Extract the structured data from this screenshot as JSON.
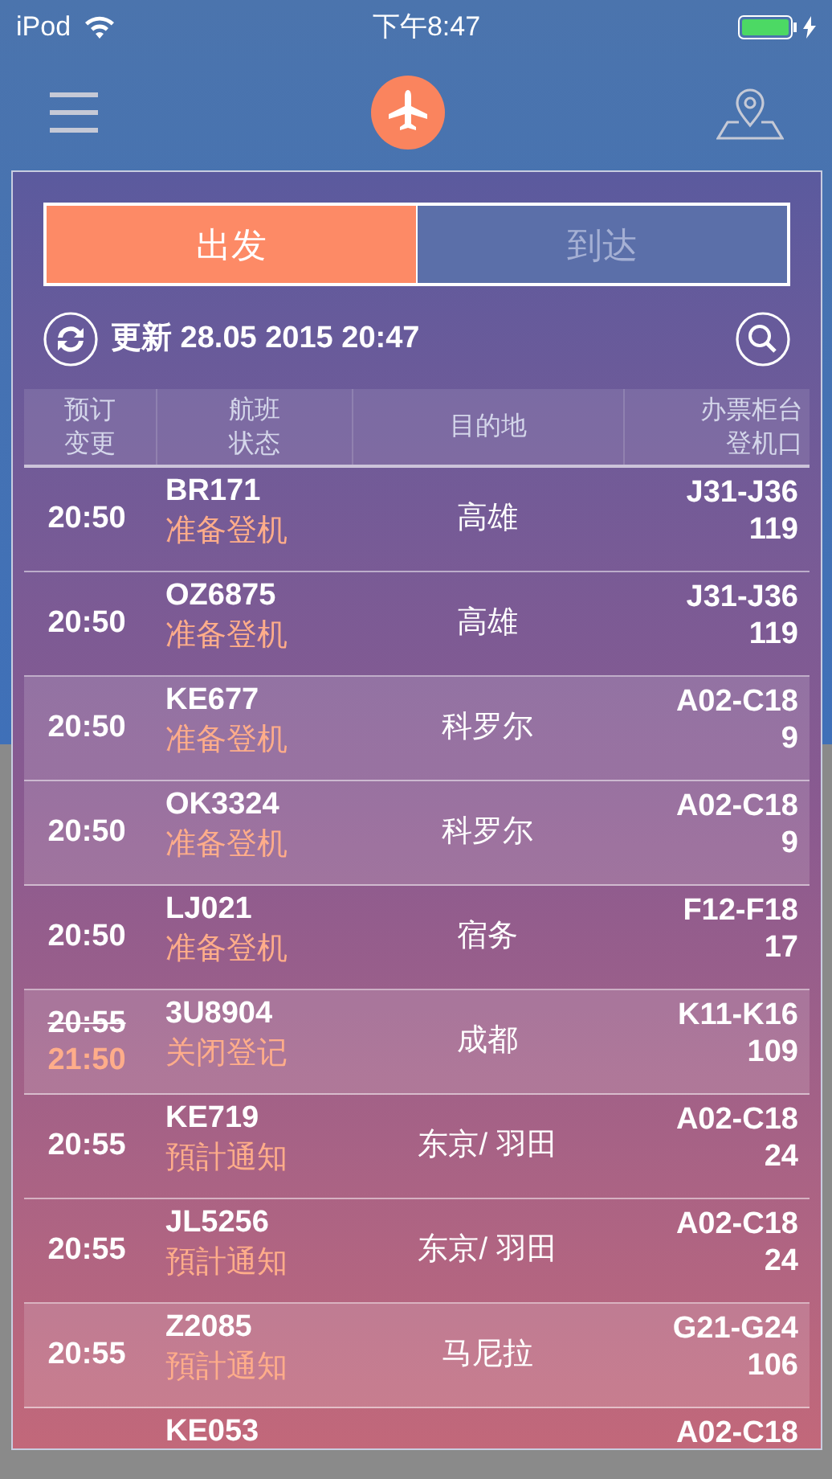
{
  "status_bar": {
    "device": "iPod",
    "time": "下午8:47",
    "charging": true
  },
  "tabs": [
    {
      "label": "出发",
      "selected": true
    },
    {
      "label": "到达",
      "selected": false
    }
  ],
  "update": {
    "text": "更新 28.05 2015 20:47"
  },
  "table": {
    "columns": [
      {
        "lines": [
          "预订",
          "变更"
        ]
      },
      {
        "lines": [
          "航班",
          "状态"
        ]
      },
      {
        "lines": [
          "目的地"
        ]
      },
      {
        "lines": [
          "办票柜台",
          "登机口"
        ]
      }
    ],
    "rows": [
      {
        "time": "20:50",
        "flight": "BR171",
        "status": "准备登机",
        "destination": "高雄",
        "counter": "J31-J36",
        "gate": "119",
        "shaded": false
      },
      {
        "time": "20:50",
        "flight": "OZ6875",
        "status": "准备登机",
        "destination": "高雄",
        "counter": "J31-J36",
        "gate": "119",
        "shaded": false
      },
      {
        "time": "20:50",
        "flight": "KE677",
        "status": "准备登机",
        "destination": "科罗尔",
        "counter": "A02-C18",
        "gate": "9",
        "shaded": true
      },
      {
        "time": "20:50",
        "flight": "OK3324",
        "status": "准备登机",
        "destination": "科罗尔",
        "counter": "A02-C18",
        "gate": "9",
        "shaded": true
      },
      {
        "time": "20:50",
        "flight": "LJ021",
        "status": "准备登机",
        "destination": "宿务",
        "counter": "F12-F18",
        "gate": "17",
        "shaded": false
      },
      {
        "time": "20:55",
        "new_time": "21:50",
        "flight": "3U8904",
        "status": "关闭登记",
        "destination": "成都",
        "counter": "K11-K16",
        "gate": "109",
        "shaded": true
      },
      {
        "time": "20:55",
        "flight": "KE719",
        "status": "預計通知",
        "destination": "东京/ 羽田",
        "counter": "A02-C18",
        "gate": "24",
        "shaded": false
      },
      {
        "time": "20:55",
        "flight": "JL5256",
        "status": "預計通知",
        "destination": "东京/ 羽田",
        "counter": "A02-C18",
        "gate": "24",
        "shaded": false
      },
      {
        "time": "20:55",
        "flight": "Z2085",
        "status": "預計通知",
        "destination": "马尼拉",
        "counter": "G21-G24",
        "gate": "106",
        "shaded": true
      },
      {
        "flight": "KE053",
        "counter": "A02-C18",
        "shaded": false
      }
    ]
  }
}
